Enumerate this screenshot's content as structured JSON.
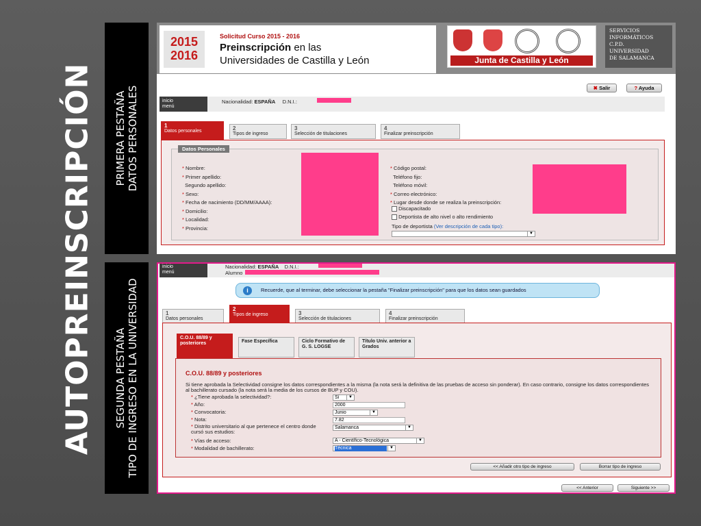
{
  "slide_title": "AUTOPREINSCRIPCIÓN",
  "band1": {
    "line1": "PRIMERA PESTAÑA",
    "line2": "DATOS PERSONALES"
  },
  "band2": {
    "line1": "SEGUNDA PESTAÑA",
    "line2": "TIPO DE INGRESO EN LA UNIVERSIDAD"
  },
  "header": {
    "year_top": "2015",
    "year_bottom": "2016",
    "solicitud": "Solicitud Curso 2015 - 2016",
    "title_bold": "Preinscripción",
    "title_rest": " en las",
    "title_line2": "Universidades de Castilla y León",
    "junta": "Junta de Castilla y León",
    "servicios": [
      "SERVICIOS",
      "INFORMÁTICOS",
      "C.P.D.",
      "UNIVERSIDAD",
      "DE SALAMANCA"
    ]
  },
  "topbar": {
    "inicio": "inicio",
    "menu": "menú",
    "nacionalidad_label": "Nacionalidad:",
    "nacionalidad": "ESPAÑA",
    "dni_label": "D.N.I.:",
    "salir": "Salir",
    "ayuda": "Ayuda",
    "alumno_label": "Alumno"
  },
  "tabs": [
    {
      "num": "1",
      "label": "Datos personales"
    },
    {
      "num": "2",
      "label": "Tipos de ingreso"
    },
    {
      "num": "3",
      "label": "Selección de titulaciones"
    },
    {
      "num": "4",
      "label": "Finalizar preinscripción"
    }
  ],
  "datos": {
    "legend": "Datos Personales",
    "left": [
      "Nombre:",
      "Primer apellido:",
      "Segundo apellido:",
      "Sexo:",
      "Fecha de nacimiento (DD/MM/AAAA):",
      "Domicilio:",
      "Localidad:",
      "Provincia:"
    ],
    "left_req": [
      true,
      true,
      false,
      true,
      true,
      true,
      true,
      true
    ],
    "right": [
      "Código postal:",
      "Teléfono fijo:",
      "Teléfono móvil:",
      "Correo electrónico:",
      "Lugar desde donde se realiza la preinscripción:"
    ],
    "right_req": [
      true,
      false,
      false,
      true,
      true
    ],
    "check1": "Discapacitado",
    "check2": "Deportista de alto nivel o alto rendimiento",
    "deportista_label": "Tipo de deportista",
    "deportista_link": "(Ver descripción de cada tipo):"
  },
  "notice": "Recuerde, que al terminar, debe seleccionar la pestaña \"Finalizar preinscripción\" para que los datos sean guardados",
  "subtabs": [
    "C.O.U. 88/89 y posteriores",
    "Fase Específica",
    "Ciclo Formativo de G. S. LOGSE",
    "Título Univ. anterior a Grados"
  ],
  "cou": {
    "title": "C.O.U. 88/89 y posteriores",
    "intro": "Si tiene aprobada la Selectividad consigne los datos correspondientes a la misma (la nota será la definitiva de las pruebas de acceso sin ponderar). En caso contrario, consigne los datos correspondientes al bachillerato cursado (la nota será la media de los cursos de BUP y COU).",
    "rows": [
      {
        "label": "¿Tiene aprobada la selectividad?:",
        "value": "Sí",
        "kind": "select"
      },
      {
        "label": "Año:",
        "value": "2000",
        "kind": "input"
      },
      {
        "label": "Convocatoria:",
        "value": "Junio",
        "kind": "select"
      },
      {
        "label": "Nota:",
        "value": "7.82",
        "kind": "input"
      },
      {
        "label": "Distrito universitario al que pertenece el centro donde cursó sus estudios:",
        "value": "Salamanca",
        "kind": "select"
      },
      {
        "label": "Vías de acceso:",
        "value": "A - Científico-Tecnológica",
        "kind": "select"
      },
      {
        "label": "Modalidad de bachillerato:",
        "value": "Técnica",
        "kind": "select"
      }
    ]
  },
  "buttons": {
    "add": "<< Añadir otro tipo de ingreso",
    "del": "Borrar tipo de ingreso",
    "prev": "<< Anterior",
    "next": "Siguiente >>"
  },
  "colors": {
    "accent": "#c51c1c",
    "redact": "#ff3d8b",
    "notice_bg": "#bfe3f5"
  }
}
